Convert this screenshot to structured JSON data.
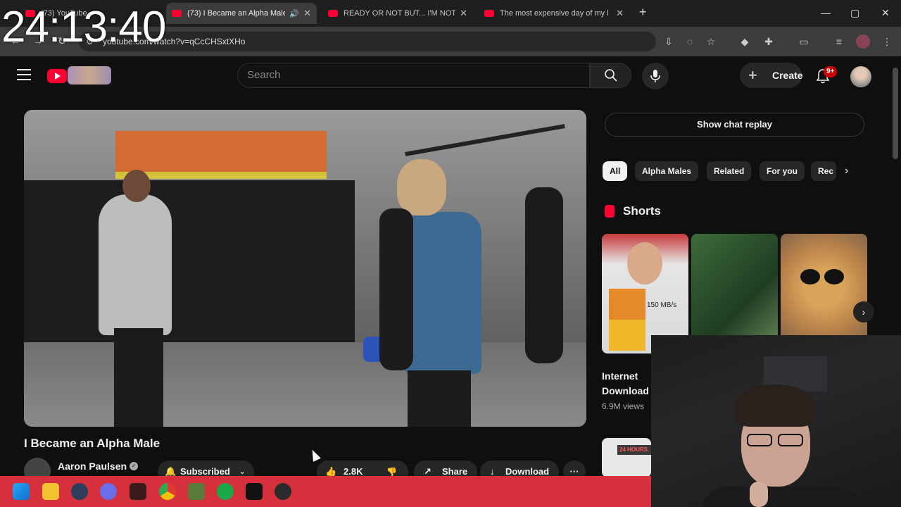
{
  "clock": "24:13:40",
  "browser": {
    "tabs": [
      {
        "title": "(73) YouTube"
      },
      {
        "title": "(73) I Became an Alpha Male"
      },
      {
        "title": "READY OR NOT BUT... I'M NOT"
      },
      {
        "title": "The most expensive day of my l"
      }
    ],
    "new_tab": "+",
    "url": "youtube.com/watch?v=qCcCHSxtXHo",
    "window_controls": {
      "minimize": "—",
      "maximize": "▢",
      "close": "✕"
    }
  },
  "youtube": {
    "search_placeholder": "Search",
    "create_label": "Create",
    "notifications_badge": "9+"
  },
  "video": {
    "title": "I Became an Alpha Male",
    "channel": "Aaron Paulsen",
    "subscribe_label": "Subscribed",
    "likes": "2.8K",
    "share_label": "Share",
    "download_label": "Download",
    "more_label": "···"
  },
  "sidebar": {
    "chat_replay_label": "Show chat replay",
    "chips": [
      "All",
      "Alpha Males",
      "Related",
      "For you",
      "Rec"
    ],
    "shorts_title": "Shorts",
    "short1_overlay_text": "150 MB/s",
    "short1_title": "Internet Download",
    "short1_views": "6.9M views",
    "thumb2_text": "24 HOURS"
  },
  "icons": {
    "menu": "hamburger-menu-icon",
    "search": "search-icon",
    "mic": "microphone-icon",
    "bell": "notification-bell-icon",
    "like": "thumbs-up-icon",
    "dislike": "thumbs-down-icon",
    "share": "share-icon",
    "download": "download-icon",
    "bell_sub": "subscribe-bell-icon"
  },
  "colors": {
    "yt_red": "#ff0033",
    "taskbar": "#d6303d",
    "background": "#0f0f0f"
  }
}
